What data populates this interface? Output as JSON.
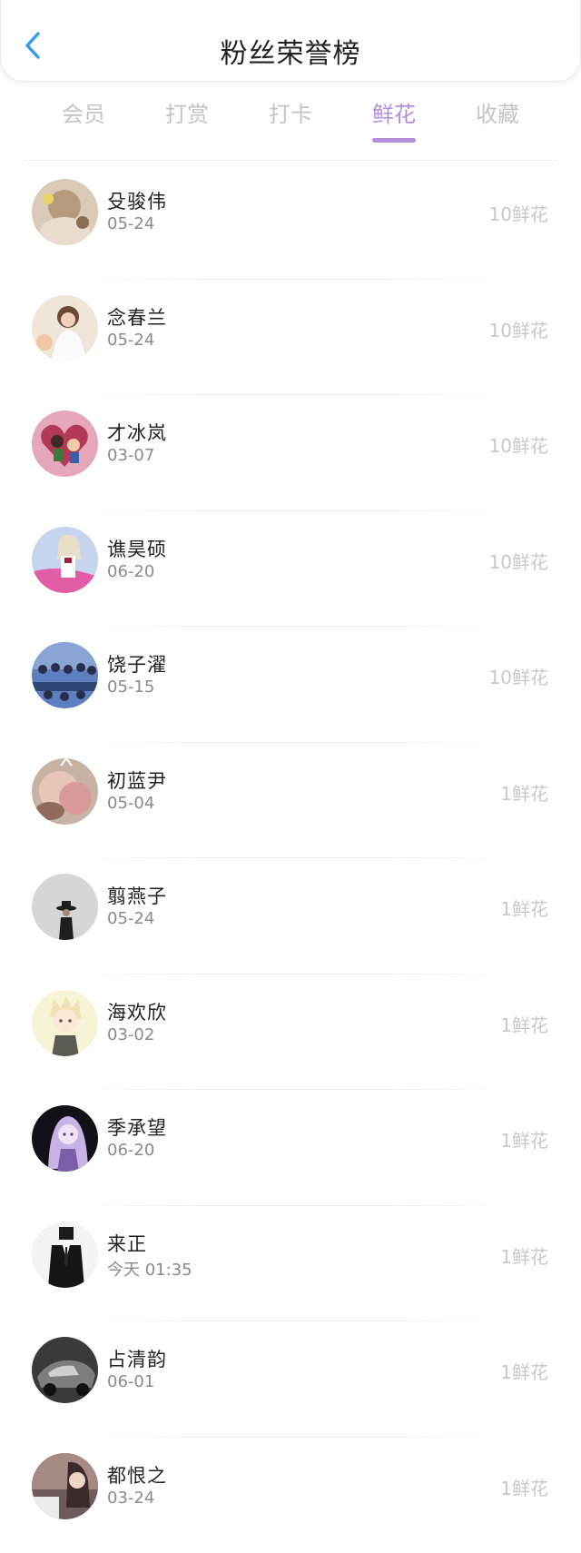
{
  "header": {
    "title": "粉丝荣誉榜",
    "back_icon": "chevron-left-icon",
    "accent_color": "#2f9ee4"
  },
  "tabs": {
    "active_color": "#b38fd9",
    "inactive_color": "#c4c4c4",
    "active_index": 3,
    "items": [
      {
        "label": "会员"
      },
      {
        "label": "打赏"
      },
      {
        "label": "打卡"
      },
      {
        "label": "鲜花"
      },
      {
        "label": "收藏"
      }
    ]
  },
  "fans": [
    {
      "name": "殳骏伟",
      "time": "05-24",
      "amount": "10鲜花",
      "avatar": "girl-with-flowers"
    },
    {
      "name": "念春兰",
      "time": "05-24",
      "amount": "10鲜花",
      "avatar": "girl-white-dress"
    },
    {
      "name": "才冰岚",
      "time": "03-07",
      "amount": "10鲜花",
      "avatar": "cartoon-heart-couple"
    },
    {
      "name": "谯昊硕",
      "time": "06-20",
      "amount": "10鲜花",
      "avatar": "pink-anime-girl"
    },
    {
      "name": "饶子濯",
      "time": "05-15",
      "amount": "10鲜花",
      "avatar": "group-photo"
    },
    {
      "name": "初蓝尹",
      "time": "05-04",
      "amount": "1鲜花",
      "avatar": "blurred-girl"
    },
    {
      "name": "翦燕子",
      "time": "05-24",
      "amount": "1鲜花",
      "avatar": "man-with-hat"
    },
    {
      "name": "海欢欣",
      "time": "03-02",
      "amount": "1鲜花",
      "avatar": "anime-blonde-boy"
    },
    {
      "name": "季承望",
      "time": "06-20",
      "amount": "1鲜花",
      "avatar": "dark-anime-girl"
    },
    {
      "name": "来正",
      "time": "今天 01:35",
      "amount": "1鲜花",
      "avatar": "man-in-suit"
    },
    {
      "name": "占清韵",
      "time": "06-01",
      "amount": "1鲜花",
      "avatar": "dark-car"
    },
    {
      "name": "都恨之",
      "time": "03-24",
      "amount": "1鲜花",
      "avatar": "girl-with-text"
    }
  ]
}
